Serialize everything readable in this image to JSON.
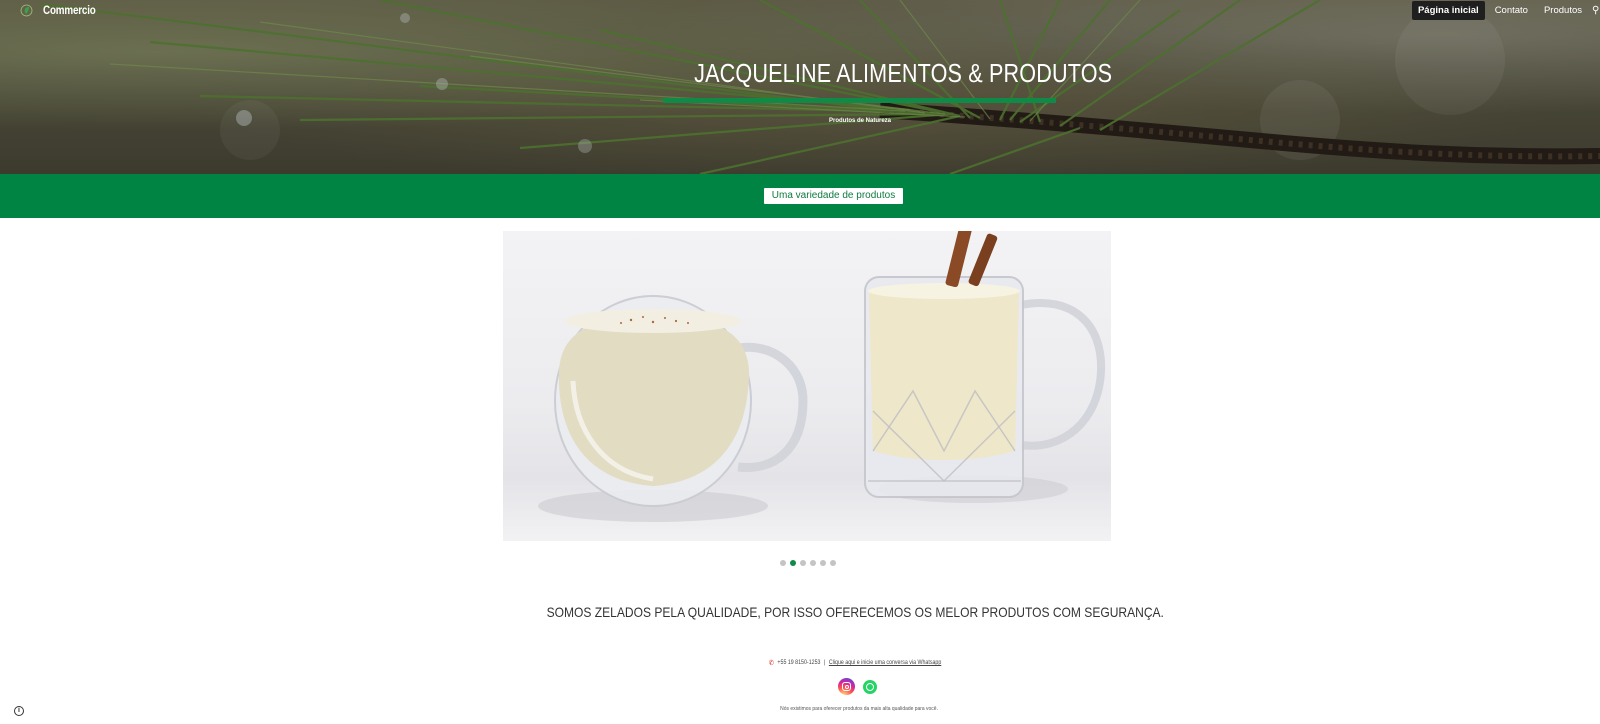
{
  "header": {
    "site_name": "Commercio",
    "nav": [
      {
        "label": "Página inicial",
        "active": true
      },
      {
        "label": "Contato",
        "active": false
      },
      {
        "label": "Produtos",
        "active": false
      }
    ]
  },
  "hero": {
    "title": "JACQUELINE ALIMENTOS & PRODUTOS",
    "subtitle": "Produtos de Natureza"
  },
  "banner": {
    "button_label": "Uma variedade de produtos"
  },
  "carousel": {
    "slide_count": 6,
    "active_index": 1
  },
  "tagline": "SOMOS ZELADOS PELA QUALIDADE, POR ISSO OFERECEMOS OS MELOR PRODUTOS COM SEGURANÇA.",
  "footer": {
    "phone": "+55 19 8150-1253",
    "separator": "|",
    "whatsapp_link": "Clique aqui e inicie uma conversa via Whatsapp",
    "note": "Nós existimos para oferecer produtos da mais alta qualidade para você."
  },
  "colors": {
    "brand_green": "#008443",
    "accent_green": "#0f8a47",
    "nav_active_bg": "#1f1f1f"
  },
  "icons": [
    "leaf-logo-icon",
    "phone-icon",
    "instagram-icon",
    "whatsapp-icon",
    "info-icon"
  ]
}
